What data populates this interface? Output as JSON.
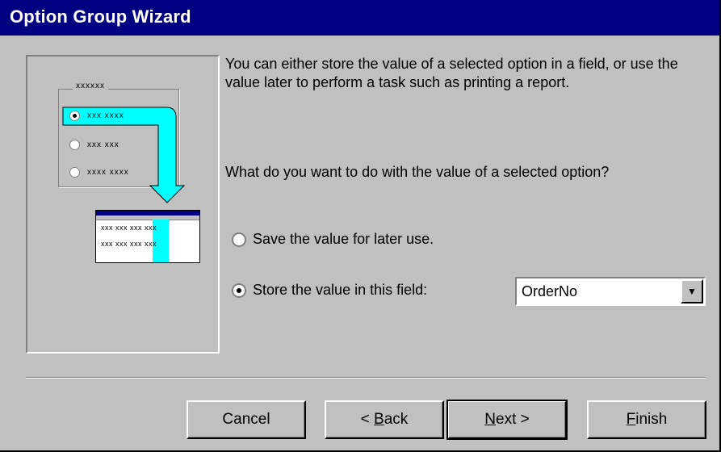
{
  "window": {
    "title": "Option Group Wizard"
  },
  "description": "You can either store the value of a selected option in a field, or use the value later to perform a task such as printing a report.",
  "question": "What do you want to do with the value of a selected option?",
  "options": [
    {
      "label": "Save the value for later use.",
      "selected": false
    },
    {
      "label": "Store the value in this field:",
      "selected": true
    }
  ],
  "field_combo": {
    "value": "OrderNo"
  },
  "buttons": {
    "cancel": "Cancel",
    "back_prefix": "< ",
    "back_accel": "B",
    "back_rest": "ack",
    "next_accel": "N",
    "next_rest": "ext >",
    "finish_accel": "F",
    "finish_rest": "inish"
  },
  "preview": {
    "group_label": "xxxxxx",
    "options": [
      "xxx xxxx",
      "xxx xxx",
      "xxxx xxxx"
    ],
    "table_rows": [
      [
        "xxx",
        "xxx",
        "xxx",
        "xxx"
      ],
      [
        "xxx",
        "xxx",
        "xxx",
        "xxx"
      ]
    ]
  },
  "colors": {
    "title_bar": "#000080",
    "face": "#c0c0c0",
    "highlight": "#00ffff"
  }
}
